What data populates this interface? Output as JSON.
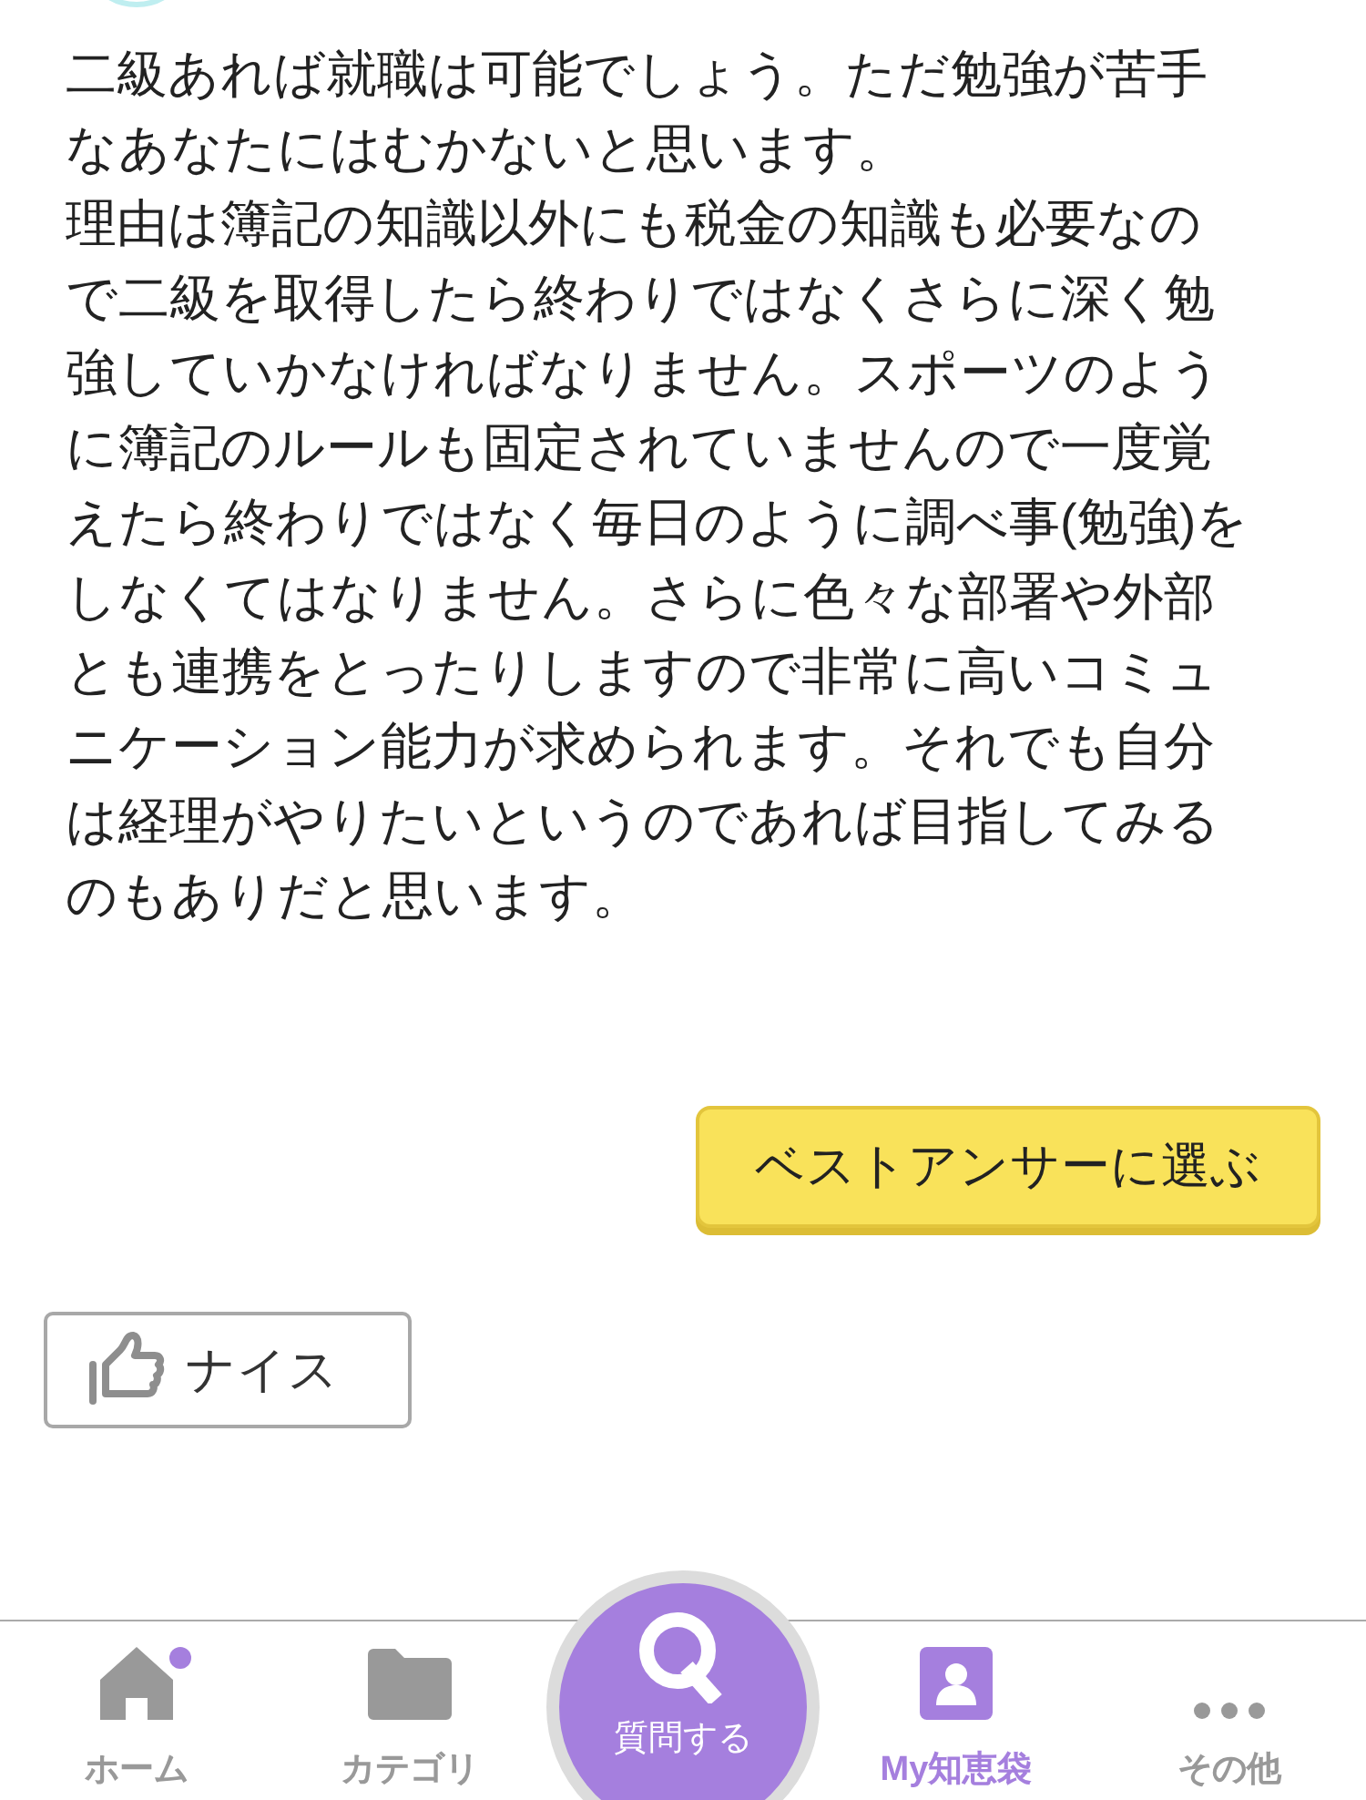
{
  "answer": {
    "lines": [
      "二級あれば就職は可能でしょう。ただ勉強が苦手",
      "なあなたにはむかないと思います。",
      "理由は簿記の知識以外にも税金の知識も必要なの",
      "で二級を取得したら終わりではなくさらに深く勉",
      "強していかなければなりません。スポーツのよう",
      "に簿記のルールも固定されていませんので一度覚",
      "えたら終わりではなく毎日のように調べ事(勉強)を",
      "しなくてはなりません。さらに色々な部署や外部",
      "とも連携をとったりしますので非常に高いコミュ",
      "ニケーション能力が求められます。それでも自分",
      "は経理がやりたいというのであれば目指してみる",
      "のもありだと思います。"
    ],
    "best_answer_button": "ベストアンサーに選ぶ",
    "nice_button": "ナイス"
  },
  "tab_bar": [
    {
      "kind": "home",
      "label": "ホーム",
      "selected": false,
      "badge": true
    },
    {
      "kind": "folder",
      "label": "カテゴリ",
      "selected": false,
      "badge": false
    },
    {
      "kind": "ask",
      "label": "質問する",
      "selected": false,
      "badge": false
    },
    {
      "kind": "profile",
      "label": "My知恵袋",
      "selected": true,
      "badge": false
    },
    {
      "kind": "more",
      "label": "その他",
      "selected": false,
      "badge": false
    }
  ]
}
